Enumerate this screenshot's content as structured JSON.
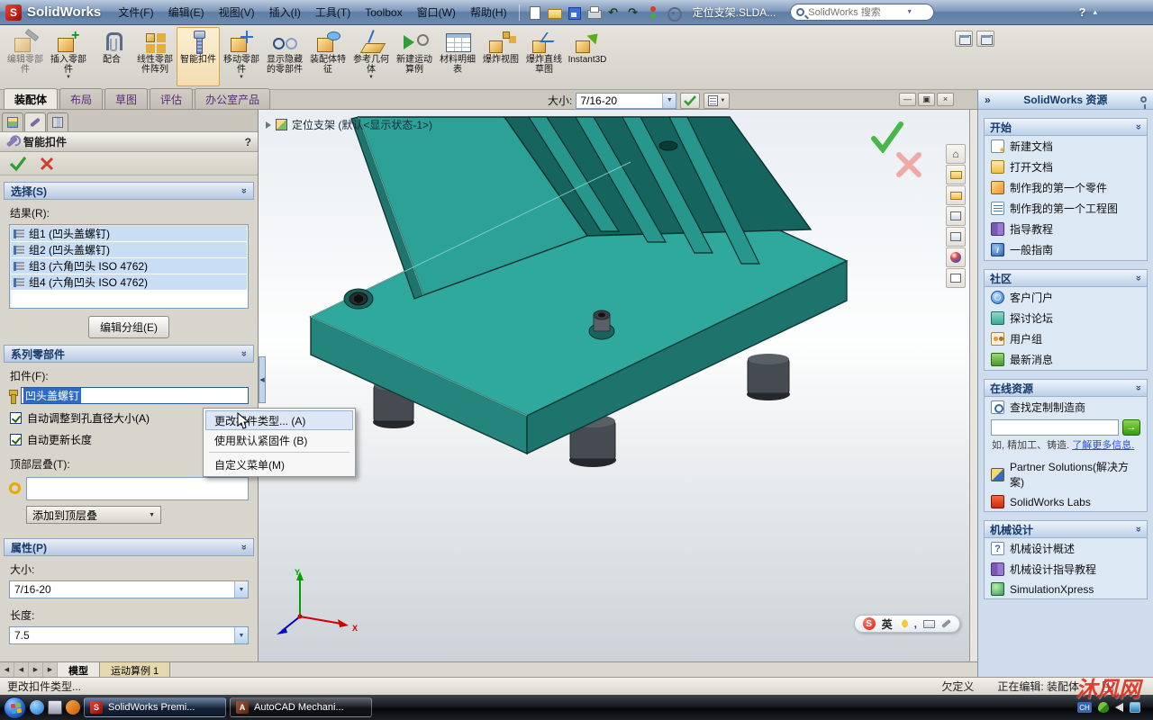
{
  "icons": {
    "dropdown": "▼",
    "up_chevron": "«",
    "right_chevron": "»",
    "left_arrow": "◀",
    "right_arrow_t": "▶",
    "minimize": "—",
    "restore": "▣",
    "close": "×",
    "undo": "↶",
    "redo": "↷",
    "help": "?",
    "collapse": "▴",
    "go_arrow": "→",
    "splitter_arrow": "◀",
    "scroll_down": "▼",
    "home": "⌂"
  },
  "titlebar": {
    "logo_initial": "S",
    "logo": "SolidWorks",
    "menus": [
      "文件(F)",
      "编辑(E)",
      "视图(V)",
      "插入(I)",
      "工具(T)",
      "Toolbox",
      "窗口(W)",
      "帮助(H)"
    ],
    "doc_title": "定位支架.SLDA...",
    "search_placeholder": "SolidWorks 搜索"
  },
  "ribbon": {
    "buttons": [
      {
        "icon": "edit-component-icon",
        "label": "编辑零部件"
      },
      {
        "icon": "insert-component-icon",
        "label": "插入零部件"
      },
      {
        "icon": "mate-icon",
        "label": "配合"
      },
      {
        "icon": "linear-pattern-icon",
        "label": "线性零部件阵列"
      },
      {
        "icon": "smart-fastener-icon",
        "label": "智能扣件"
      },
      {
        "icon": "move-component-icon",
        "label": "移动零部件"
      },
      {
        "icon": "show-hidden-icon",
        "label": "显示隐藏的零部件"
      },
      {
        "icon": "assembly-feature-icon",
        "label": "装配体特征"
      },
      {
        "icon": "reference-geometry-icon",
        "label": "参考几何体"
      },
      {
        "icon": "new-motion-study-icon",
        "label": "新建运动算例"
      },
      {
        "icon": "bom-icon",
        "label": "材料明细表"
      },
      {
        "icon": "exploded-view-icon",
        "label": "爆炸视图"
      },
      {
        "icon": "explode-sketch-icon",
        "label": "爆炸直线草图"
      },
      {
        "icon": "instant3d-icon",
        "label": "Instant3D"
      }
    ]
  },
  "tabs": [
    "装配体",
    "布局",
    "草图",
    "评估",
    "办公室产品"
  ],
  "sizebar": {
    "label": "大小:",
    "value": "7/16-20"
  },
  "pm": {
    "title": "智能扣件",
    "selection": "选择(S)",
    "results_label": "结果(R):",
    "results": [
      "组1 (凹头盖螺钉)",
      "组2 (凹头盖螺钉)",
      "组3 (六角凹头 ISO 4762)",
      "组4 (六角凹头 ISO 4762)"
    ],
    "edit_group": "编辑分组(E)",
    "series": "系列零部件",
    "fastener_label": "扣件(F):",
    "fastener_value": "凹头盖螺钉",
    "auto_size": "自动调整到孔直径大小(A)",
    "auto_length": "自动更新长度",
    "top_stack": "顶部层叠(T):",
    "add_top_stack": "添加到顶层叠",
    "properties": "属性(P)",
    "size_label": "大小:",
    "size_value": "7/16-20",
    "length_label": "长度:",
    "length_value": "7.5"
  },
  "ctx": {
    "items": [
      "更改扣件类型... (A)",
      "使用默认紧固件 (B)",
      "自定义菜单(M)"
    ]
  },
  "viewport": {
    "doc_label": "定位支架 (默认<显示状态-1>)"
  },
  "sogou": {
    "logo": "S",
    "mode": "英",
    "punct": ","
  },
  "taskpane": {
    "title": "SolidWorks 资源",
    "sections": [
      {
        "title": "开始",
        "items": [
          {
            "icon": "new-document-icon",
            "label": "新建文档"
          },
          {
            "icon": "open-document-icon",
            "label": "打开文档"
          },
          {
            "icon": "first-part-icon",
            "label": "制作我的第一个零件"
          },
          {
            "icon": "first-drawing-icon",
            "label": "制作我的第一个工程图"
          },
          {
            "icon": "tutorials-icon",
            "label": "指导教程"
          },
          {
            "icon": "general-info-icon",
            "label": "一般指南"
          }
        ]
      },
      {
        "title": "社区",
        "items": [
          {
            "icon": "customer-portal-icon",
            "label": "客户门户"
          },
          {
            "icon": "discussion-forum-icon",
            "label": "探讨论坛"
          },
          {
            "icon": "user-groups-icon",
            "label": "用户组"
          },
          {
            "icon": "latest-news-icon",
            "label": "最新消息"
          }
        ]
      },
      {
        "title": "在线资源",
        "items": [
          {
            "icon": "search-manufacturer-icon",
            "label": "查找定制制造商"
          }
        ],
        "note": "如, 精加工、铸造.",
        "link": "了解更多信息.",
        "extra": [
          {
            "icon": "partner-solutions-icon",
            "label": "Partner Solutions(解决方案)"
          },
          {
            "icon": "solidworks-labs-icon",
            "label": "SolidWorks Labs"
          }
        ]
      },
      {
        "title": "机械设计",
        "items": [
          {
            "icon": "overview-question-icon",
            "label": "机械设计概述"
          },
          {
            "icon": "design-tutorials-icon",
            "label": "机械设计指导教程"
          },
          {
            "icon": "simulationxpress-icon",
            "label": "SimulationXpress"
          }
        ]
      }
    ]
  },
  "mtabs": {
    "model": "模型",
    "motion": "运动算例 1"
  },
  "status": {
    "hint": "更改扣件类型...",
    "state": "欠定义",
    "editing": "正在编辑: 装配体"
  },
  "taskbar": {
    "apps": [
      {
        "icon": "solidworks-app-icon",
        "label": "SolidWorks Premi..."
      },
      {
        "icon": "autocad-app-icon",
        "label": "AutoCAD Mechani..."
      }
    ]
  },
  "watermark": "沐风网"
}
